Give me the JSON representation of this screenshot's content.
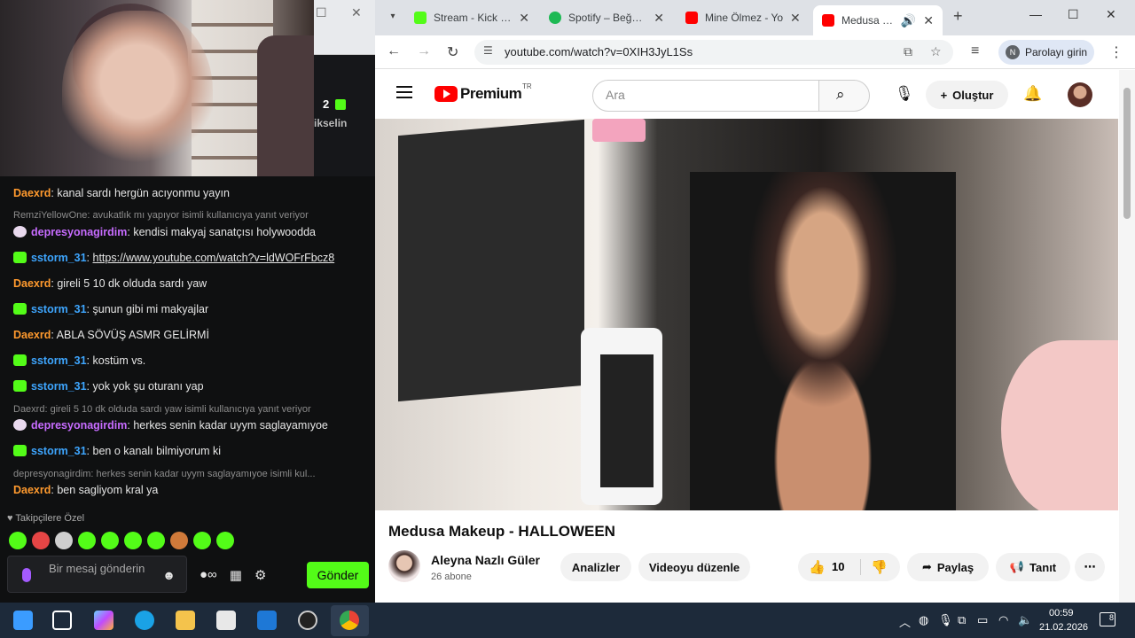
{
  "chat": {
    "behind_count": "2",
    "behind_label": "ikselin",
    "messages": [
      {
        "user": "Daexrd",
        "text": ": kanal sardı hergün acıyonmu yayın"
      },
      {
        "reply": "RemziYellowOne: avukatlık mı yapıyor isimli kullanıcıya yanıt veriyor"
      },
      {
        "user": "depresyonagirdim",
        "text": ": kendisi makyaj sanatçısı holywoodda"
      },
      {
        "user": "sstorm_31",
        "link": "https://www.youtube.com/watch?v=ldWOFrFbcz8"
      },
      {
        "user": "Daexrd",
        "text": ": gireli 5 10 dk olduda sardı yaw"
      },
      {
        "user": "sstorm_31",
        "text": ": şunun gibi mi makyajlar"
      },
      {
        "user": "Daexrd",
        "text": ": ABLA SÖVÜŞ ASMR GELİRMİ"
      },
      {
        "user": "sstorm_31",
        "text": ": kostüm vs."
      },
      {
        "user": "sstorm_31",
        "text": ": yok yok şu oturanı yap"
      },
      {
        "reply": "Daexrd: gireli 5 10 dk olduda sardı yaw isimli kullanıcıya yanıt veriyor"
      },
      {
        "user": "depresyonagirdim",
        "text": ": herkes senin kadar uyym saglayamıyoe"
      },
      {
        "user": "sstorm_31",
        "text": ": ben o kanalı bilmiyorum ki"
      },
      {
        "reply": "depresyonagirdim: herkes senin kadar uyym saglayamıyoe isimli kul..."
      },
      {
        "user": "Daexrd",
        "text": ": ben sagliyom kral ya"
      }
    ],
    "followers_only": "Takipçilere Özel",
    "input_placeholder": "Bir mesaj gönderin",
    "send_label": "Gönder",
    "colors": {
      "accent": "#53fc18",
      "orange_user": "#ff9a2e",
      "blue_user": "#3ea6ff",
      "purple_user": "#c76cff"
    }
  },
  "browser": {
    "tabs": [
      {
        "title": "Stream - Kick Da",
        "icon": "kick-icon"
      },
      {
        "title": "Spotify – Beğenil",
        "icon": "spotify-icon"
      },
      {
        "title": "Mine Ölmez - Yo",
        "icon": "youtube-icon"
      },
      {
        "title": "Medusa Mak",
        "icon": "youtube-icon",
        "active": true
      }
    ],
    "url": "youtube.com/watch?v=0XIH3JyL1Ss",
    "password_chip": "Parolayı girin",
    "password_initial": "N"
  },
  "youtube": {
    "brand": "Premium",
    "country": "TR",
    "search_placeholder": "Ara",
    "create_label": "Oluştur",
    "video_title": "Medusa Makeup - HALLOWEEN",
    "channel_name": "Aleyna Nazlı Güler",
    "subscribers": "26 abone",
    "analytics_label": "Analizler",
    "edit_label": "Videoyu düzenle",
    "likes": "10",
    "share_label": "Paylaş",
    "promote_label": "Tanıt"
  },
  "taskbar": {
    "time": "00:59",
    "date": "21.02.2026",
    "notifications": "8"
  }
}
